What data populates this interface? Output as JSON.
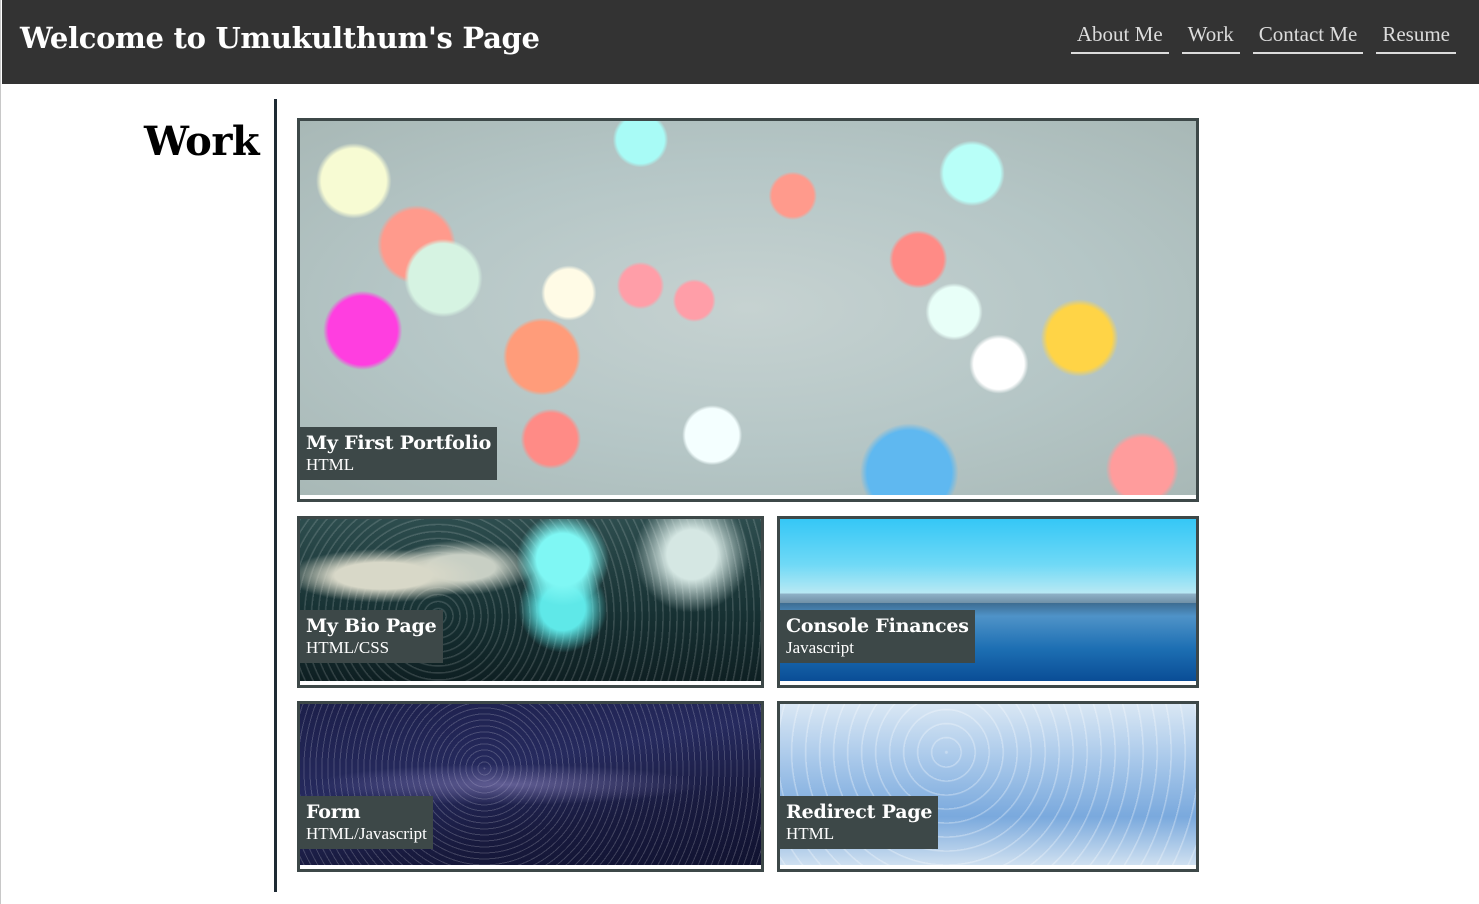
{
  "header": {
    "title": "Welcome to Umukulthum's Page",
    "nav": [
      {
        "label": "About Me"
      },
      {
        "label": "Work"
      },
      {
        "label": "Contact Me"
      },
      {
        "label": "Resume"
      }
    ]
  },
  "work": {
    "heading": "Work",
    "projects": [
      {
        "title": "My First Portfolio",
        "tech": "HTML"
      },
      {
        "title": "My Bio Page",
        "tech": "HTML/CSS"
      },
      {
        "title": "Console Finances",
        "tech": "Javascript"
      },
      {
        "title": "Form",
        "tech": "HTML/Javascript"
      },
      {
        "title": "Redirect Page",
        "tech": "HTML"
      }
    ]
  }
}
